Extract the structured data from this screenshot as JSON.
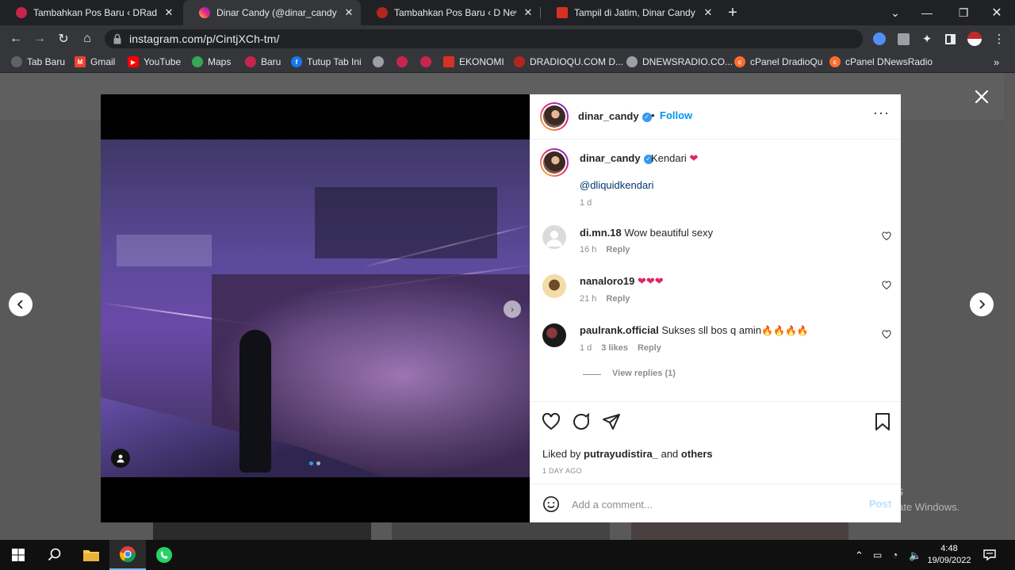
{
  "browser": {
    "tabs": [
      {
        "title": "Tambahkan Pos Baru ‹ DRadioQu",
        "favicon_color": "#c7254e",
        "active": false
      },
      {
        "title": "Dinar Candy (@dinar_candy) • Instagram",
        "favicon_color": "#e1306c",
        "active": true
      },
      {
        "title": "Tambahkan Pos Baru ‹ D News Radio",
        "favicon_color": "#b3261e",
        "active": false
      },
      {
        "title": "Tampil di Jatim, Dinar Candy Disambut",
        "favicon_color": "#d93025",
        "active": false
      }
    ],
    "new_tab_icon": "plus-icon",
    "url": "instagram.com/p/CintjXCh-tm/",
    "bookmarks": [
      {
        "label": "Tab Baru",
        "icon_color": "#5f6368"
      },
      {
        "label": "Gmail",
        "icon_color": "#ea4335"
      },
      {
        "label": "YouTube",
        "icon_color": "#ff0000"
      },
      {
        "label": "Maps",
        "icon_color": "#34a853"
      },
      {
        "label": "Baru",
        "icon_color": "#c7254e"
      },
      {
        "label": "Tutup Tab Ini",
        "icon_color": "#1877f2"
      },
      {
        "label": "",
        "icon_color": "#9aa0a6"
      },
      {
        "label": "",
        "icon_color": "#c7254e"
      },
      {
        "label": "",
        "icon_color": "#c7254e"
      },
      {
        "label": "EKONOMI",
        "icon_color": "#d93025"
      },
      {
        "label": "DRADIOQU.COM D...",
        "icon_color": "#b3261e"
      },
      {
        "label": "DNEWSRADIO.CO...",
        "icon_color": "#9aa0a6"
      },
      {
        "label": "cPanel DradioQu",
        "icon_color": "#ff6c2c"
      },
      {
        "label": "cPanel DNewsRadio",
        "icon_color": "#ff6c2c"
      }
    ]
  },
  "post": {
    "username": "dinar_candy",
    "follow_label": "Follow",
    "caption_text": "Kendari",
    "caption_mention": "@dliquidkendari",
    "caption_time": "1 d",
    "comments": [
      {
        "user": "di.mn.18",
        "text": "Wow beautiful sexy",
        "time": "16 h",
        "likes": "",
        "reply": "Reply"
      },
      {
        "user": "nanaloro19",
        "text": "",
        "time": "21 h",
        "likes": "",
        "reply": "Reply"
      },
      {
        "user": "paulrank.official",
        "text": "Sukses sll bos q amin",
        "time": "1 d",
        "likes": "3 likes",
        "reply": "Reply"
      }
    ],
    "view_replies": "View replies (1)",
    "liked_by_prefix": "Liked by",
    "liked_by_user": "putrayudistira_",
    "liked_by_and": "and",
    "liked_by_others": "others",
    "date": "1 DAY AGO",
    "comment_placeholder": "Add a comment...",
    "post_label": "Post"
  },
  "watermark": {
    "line1": "Activate Windows",
    "line2": "Go to Settings to activate Windows."
  },
  "taskbar": {
    "time": "4:48",
    "date": "19/09/2022"
  }
}
